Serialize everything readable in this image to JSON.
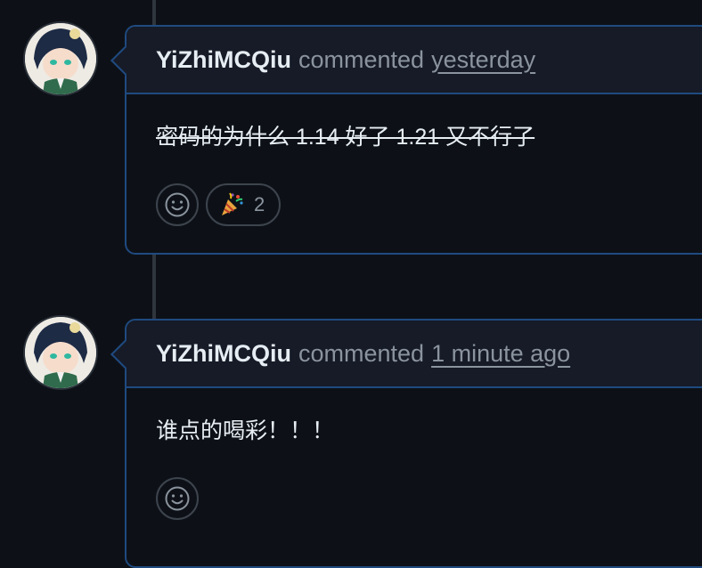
{
  "comments": [
    {
      "author": "YiZhiMCQiu",
      "verb": "commented",
      "when": "yesterday",
      "body": "密码的为什么 1.14 好了 1.21 又不行了",
      "body_struck": true,
      "reactions": [
        {
          "emoji": "🎉",
          "count": "2"
        }
      ]
    },
    {
      "author": "YiZhiMCQiu",
      "verb": "commented",
      "when": "1 minute ago",
      "body": "谁点的喝彩！！！",
      "body_struck": false,
      "reactions": []
    }
  ],
  "icons": {
    "add_reaction": "smiley-icon",
    "tada": "tada-icon"
  },
  "colors": {
    "background": "#0d1117",
    "card_border": "#1f4a80",
    "header_bg": "#161b27",
    "muted": "#8b949e"
  }
}
